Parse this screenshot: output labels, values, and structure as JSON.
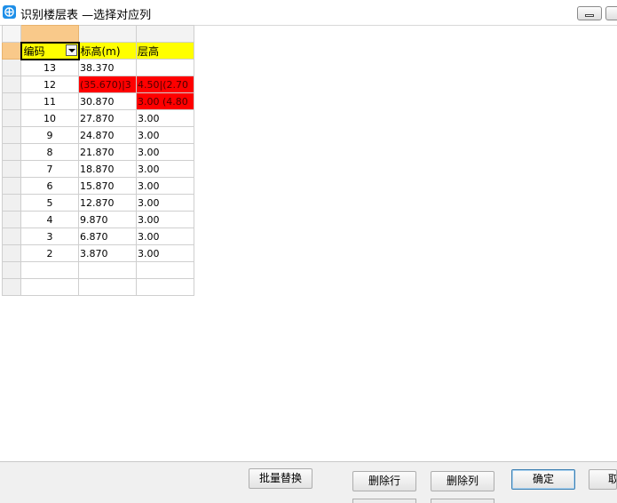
{
  "window": {
    "title": "识别楼层表 —选择对应列",
    "icon": "app-logo-icon"
  },
  "grid": {
    "headers": [
      "编码",
      "标高(m)",
      "层高"
    ],
    "rows": [
      {
        "code": "13",
        "elevation": "38.370",
        "height": "",
        "elevation_error": false,
        "height_error": false
      },
      {
        "code": "12",
        "elevation": "(35.670)|3",
        "height": "4.50|(2.70",
        "elevation_error": true,
        "height_error": true
      },
      {
        "code": "11",
        "elevation": "30.870",
        "height": "3.00 (4.80",
        "elevation_error": false,
        "height_error": true
      },
      {
        "code": "10",
        "elevation": "27.870",
        "height": "3.00",
        "elevation_error": false,
        "height_error": false
      },
      {
        "code": "9",
        "elevation": "24.870",
        "height": "3.00",
        "elevation_error": false,
        "height_error": false
      },
      {
        "code": "8",
        "elevation": "21.870",
        "height": "3.00",
        "elevation_error": false,
        "height_error": false
      },
      {
        "code": "7",
        "elevation": "18.870",
        "height": "3.00",
        "elevation_error": false,
        "height_error": false
      },
      {
        "code": "6",
        "elevation": "15.870",
        "height": "3.00",
        "elevation_error": false,
        "height_error": false
      },
      {
        "code": "5",
        "elevation": "12.870",
        "height": "3.00",
        "elevation_error": false,
        "height_error": false
      },
      {
        "code": "4",
        "elevation": "9.870",
        "height": "3.00",
        "elevation_error": false,
        "height_error": false
      },
      {
        "code": "3",
        "elevation": "6.870",
        "height": "3.00",
        "elevation_error": false,
        "height_error": false
      },
      {
        "code": "2",
        "elevation": "3.870",
        "height": "3.00",
        "elevation_error": false,
        "height_error": false
      }
    ],
    "empty_rows": 2,
    "error_color": "#ff0000",
    "header_color": "#ffff00",
    "selected_column_color": "#f9c98a"
  },
  "buttons": {
    "batch_replace": "批量替换",
    "delete_row": "删除行",
    "delete_column": "删除列",
    "confirm": "确定",
    "cancel": "取"
  }
}
